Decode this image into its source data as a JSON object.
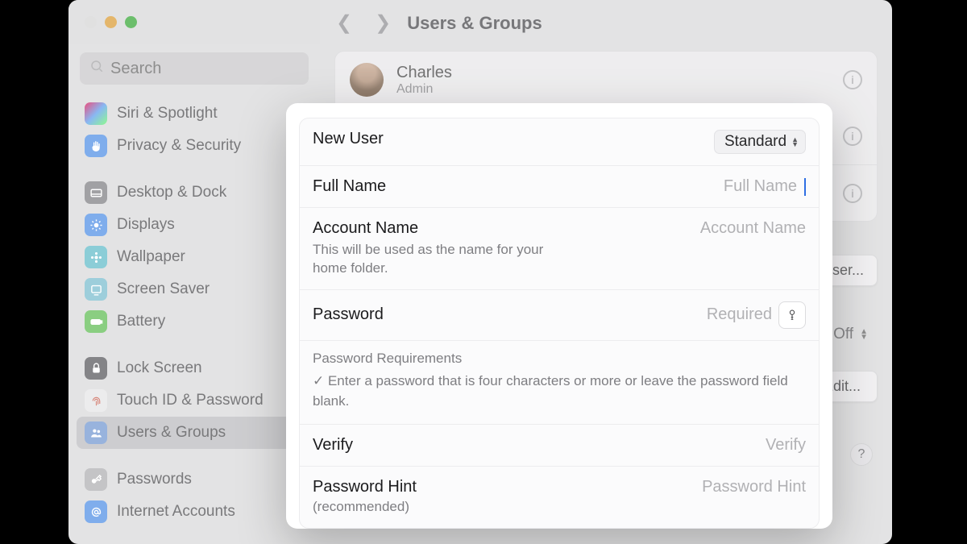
{
  "sidebar": {
    "search_placeholder": "Search",
    "items": [
      {
        "label": "Siri & Spotlight"
      },
      {
        "label": "Privacy & Security"
      },
      {
        "label": "Desktop & Dock"
      },
      {
        "label": "Displays"
      },
      {
        "label": "Wallpaper"
      },
      {
        "label": "Screen Saver"
      },
      {
        "label": "Battery"
      },
      {
        "label": "Lock Screen"
      },
      {
        "label": "Touch ID & Password"
      },
      {
        "label": "Users & Groups"
      },
      {
        "label": "Passwords"
      },
      {
        "label": "Internet Accounts"
      }
    ]
  },
  "header": {
    "title": "Users & Groups"
  },
  "user": {
    "name": "Charles",
    "role": "Admin"
  },
  "buttons": {
    "add_user": "Add User...",
    "edit": "Edit...",
    "off": "Off"
  },
  "modal": {
    "new_user_label": "New User",
    "new_user_type": "Standard",
    "full_name_label": "Full Name",
    "full_name_placeholder": "Full Name",
    "account_name_label": "Account Name",
    "account_name_sub": "This will be used as the name for your home folder.",
    "account_name_placeholder": "Account Name",
    "password_label": "Password",
    "password_placeholder": "Required",
    "requirements_title": "Password Requirements",
    "requirements_line": "✓ Enter a password that is four characters or more or leave the password field blank.",
    "verify_label": "Verify",
    "verify_placeholder": "Verify",
    "hint_label": "Password Hint",
    "hint_sub": "(recommended)",
    "hint_placeholder": "Password Hint"
  }
}
